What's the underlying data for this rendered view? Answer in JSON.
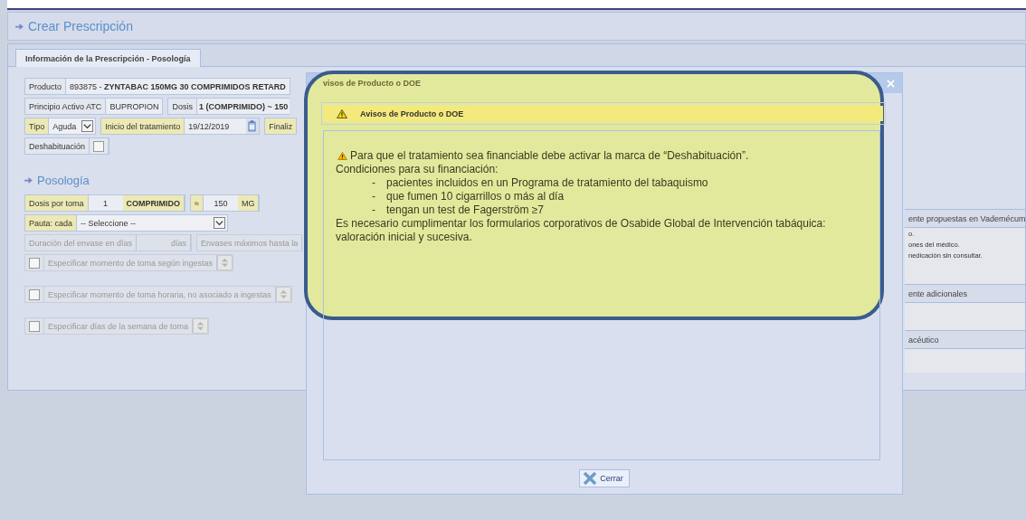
{
  "header": {
    "title": "Crear Prescripción"
  },
  "tabs": [
    {
      "label": "Información de la Prescripción - Posología",
      "selected": true
    }
  ],
  "product": {
    "label": "Producto",
    "value": "893875 - **ZYNTABAC 150MG 30 COMPRIMIDOS RETARD**"
  },
  "principio": {
    "label": "Principio Activo ATC",
    "value": "BUPROPION"
  },
  "dosis": {
    "label": "Dosis",
    "value": "1 (COMPRIMIDO) ~ 150"
  },
  "tipo": {
    "label": "Tipo",
    "value": "Aguda",
    "required": true
  },
  "inicio": {
    "label": "Inicio del tratamiento",
    "value": "19/12/2019",
    "required": true
  },
  "finaliz": {
    "label": "Finaliz",
    "required": true
  },
  "deshabituacion": {
    "label": "Deshabituación",
    "checked": false
  },
  "posologia": {
    "title": "Posología"
  },
  "dosis_por_toma": {
    "label": "Dosis por toma",
    "quantity": "1",
    "unit": "COMPRIMIDO",
    "approx": "≈",
    "amount": "150",
    "amount_unit": "MG",
    "required": true
  },
  "pauta": {
    "label": "Pauta: cada",
    "value": "-- Seleccione --",
    "required": true
  },
  "duracion": {
    "label": "Duración del envase en días",
    "unit": "días",
    "disabled": true
  },
  "envases": {
    "label": "Envases máximos hasta la",
    "disabled": true
  },
  "options": [
    {
      "label": "Especificar momento de toma según ingestas",
      "checked": false,
      "disabled": true
    },
    {
      "label": "Especificar momento de toma horaria, no asociado a ingestas",
      "checked": false,
      "disabled": true
    },
    {
      "label": "Especificar días de la semana de toma",
      "checked": false,
      "disabled": true
    }
  ],
  "right_panel": {
    "sections": [
      {
        "title": "ente propuestas en Vademécum",
        "lines": [
          "o.",
          "ones del médico.",
          "nedicación sin consultar."
        ]
      },
      {
        "title": "ente adicionales"
      },
      {
        "title": "acéutico"
      }
    ]
  },
  "dialog": {
    "title": "visos de Producto o DOE",
    "notice_header": "Avisos de Producto o DOE",
    "intro": "Para que el tratamiento sea financiable debe activar la marca de “Deshabituación”.",
    "conditions_title": "Condiciones para su financiación:",
    "conditions": [
      "pacientes incluidos en un Programa de tratamiento del tabaquismo",
      "que fumen 10 cigarrillos o más al día",
      "tengan un test de Fagerström ≥7"
    ],
    "footer": "Es necesario cumplimentar los formularios corporativos de Osabide Global de Intervención tabáquica: valoración inicial y sucesiva.",
    "bullet": "-",
    "close_button": "Cerrar"
  }
}
